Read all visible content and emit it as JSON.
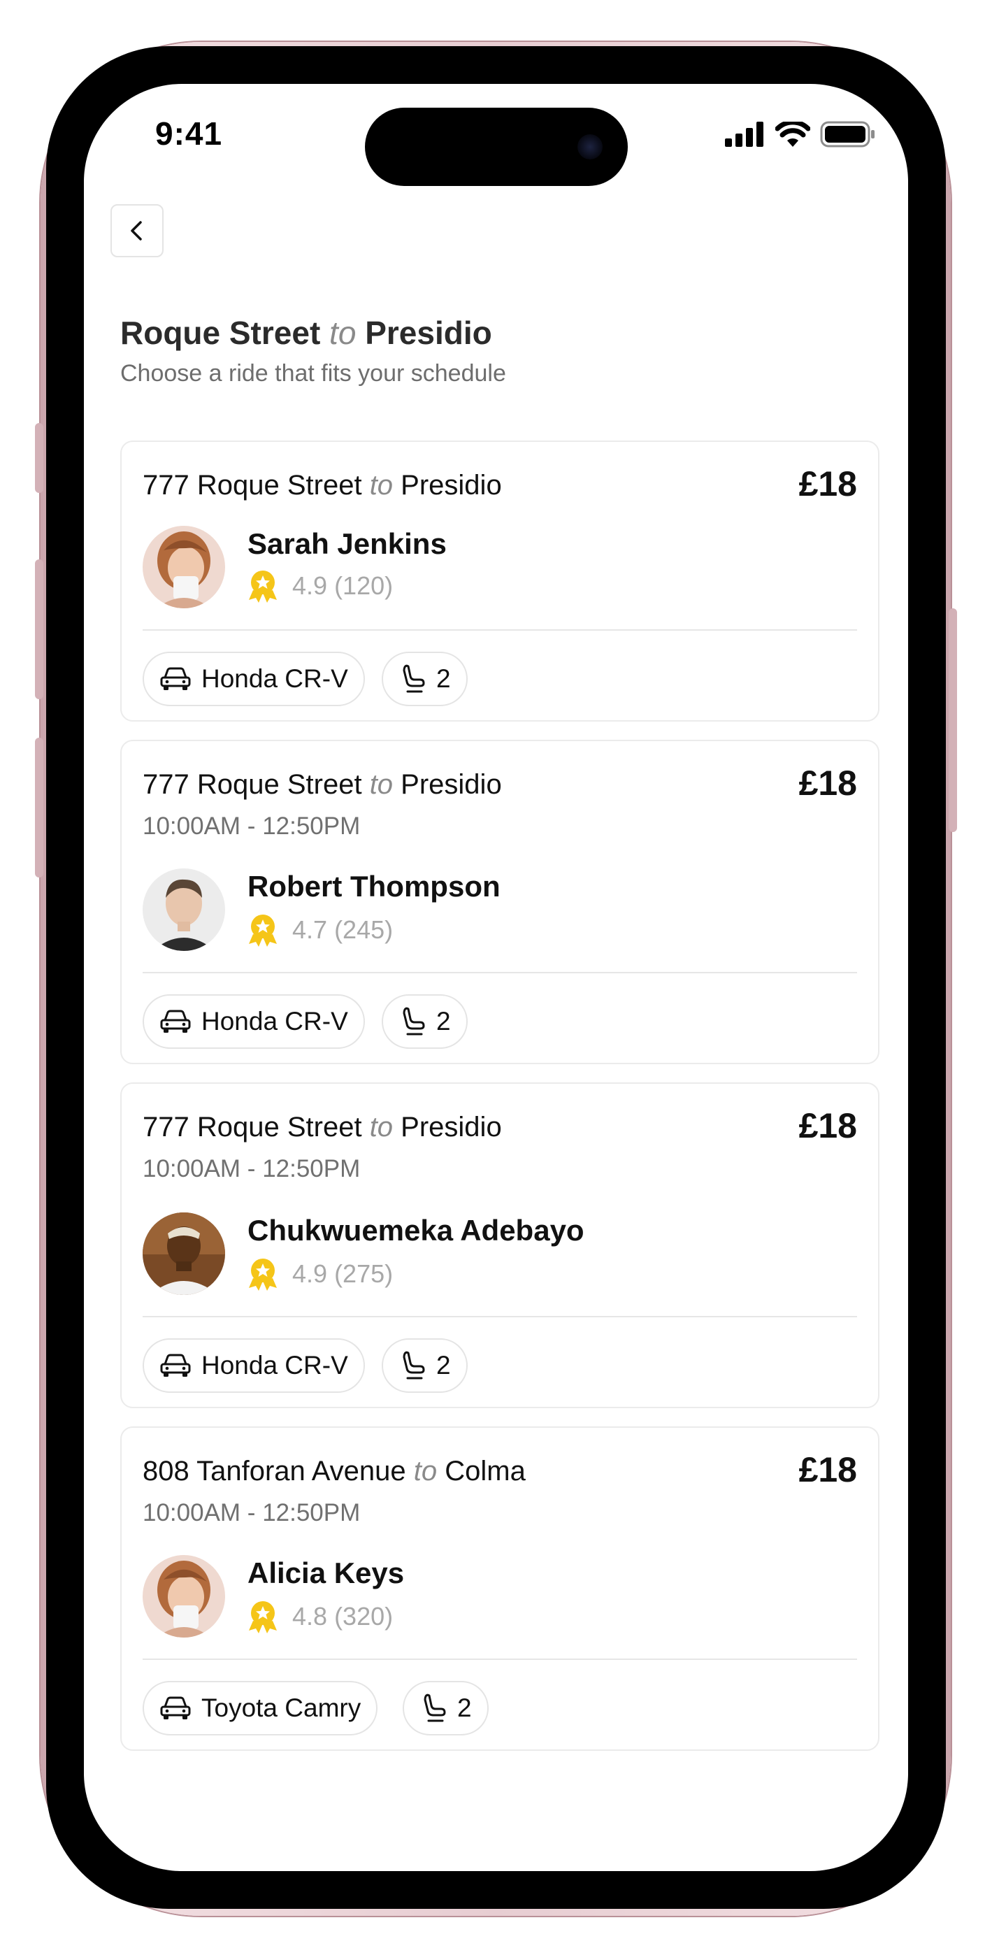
{
  "status_bar": {
    "time": "9:41"
  },
  "header": {
    "title_from": "Roque Street",
    "title_to_word": "to",
    "title_dest": "Presidio",
    "subtitle": "Choose a ride that fits your schedule"
  },
  "rides": [
    {
      "origin": "777 Roque Street",
      "to_word": "to",
      "destination": "Presidio",
      "price": "£18",
      "time_range": "",
      "driver": "Sarah Jenkins",
      "rating": "4.9",
      "reviews": "(120)",
      "vehicle": "Honda CR-V",
      "seats": "2"
    },
    {
      "origin": "777 Roque Street",
      "to_word": "to",
      "destination": "Presidio",
      "price": "£18",
      "time_range": "10:00AM - 12:50PM",
      "driver": "Robert Thompson",
      "rating": "4.7",
      "reviews": "(245)",
      "vehicle": "Honda CR-V",
      "seats": "2"
    },
    {
      "origin": "777 Roque Street",
      "to_word": "to",
      "destination": "Presidio",
      "price": "£18",
      "time_range": "10:00AM - 12:50PM",
      "driver": "Chukwuemeka Adebayo",
      "rating": "4.9",
      "reviews": "(275)",
      "vehicle": "Honda CR-V",
      "seats": "2"
    },
    {
      "origin": "808 Tanforan Avenue",
      "to_word": "to",
      "destination": "Colma",
      "price": "£18",
      "time_range": "10:00AM - 12:50PM",
      "driver": "Alicia Keys",
      "rating": "4.8",
      "reviews": "(320)",
      "vehicle": "Toyota Camry",
      "seats": "2"
    }
  ],
  "icons": {
    "back": "chevron-left-icon",
    "rating": "award-badge-icon",
    "vehicle": "car-icon",
    "seats": "seat-icon"
  },
  "colors": {
    "accent_badge": "#f5c518",
    "muted_text": "#8a8a8a",
    "phone_frame": "#e7cdd2"
  }
}
